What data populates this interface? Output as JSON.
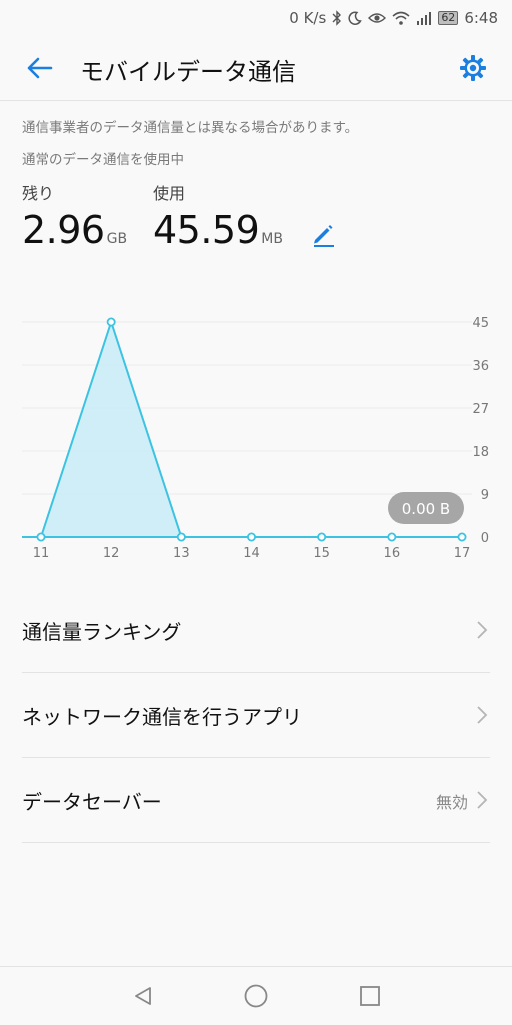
{
  "status_bar": {
    "speed": "0 K/s",
    "battery": "62",
    "time": "6:48",
    "icons": [
      "bluetooth-icon",
      "moon-icon",
      "eye-icon",
      "wifi-icon",
      "signal-icon",
      "battery-icon"
    ]
  },
  "header": {
    "title": "モバイルデータ通信",
    "back_icon": "arrow-left-icon",
    "settings_icon": "gear-icon"
  },
  "info": {
    "note": "通信事業者のデータ通信量とは異なる場合があります。",
    "status": "通常のデータ通信を使用中"
  },
  "stats": {
    "remaining_label": "残り",
    "remaining_value": "2.96",
    "remaining_unit": "GB",
    "used_label": "使用",
    "used_value": "45.59",
    "used_unit": "MB",
    "edit_icon": "pencil-icon"
  },
  "chart_data": {
    "type": "area",
    "x": [
      "11",
      "12",
      "13",
      "14",
      "15",
      "16",
      "17"
    ],
    "values": [
      0,
      45,
      0,
      0,
      0,
      0,
      0
    ],
    "yticks": [
      "45",
      "36",
      "27",
      "18",
      "9",
      "0"
    ],
    "ylim": [
      0,
      45
    ],
    "tooltip": "0.00 B",
    "grid": true,
    "colors": {
      "line": "#3cc3e2",
      "fill": "#c8ecf7",
      "tooltip": "#a6a6a6"
    }
  },
  "list": [
    {
      "label": "通信量ランキング",
      "value": ""
    },
    {
      "label": "ネットワーク通信を行うアプリ",
      "value": ""
    },
    {
      "label": "データセーバー",
      "value": "無効"
    }
  ],
  "nav": {
    "back_icon": "triangle-back-icon",
    "home_icon": "circle-home-icon",
    "recents_icon": "square-recents-icon"
  },
  "colors": {
    "accent": "#1a7fe0"
  }
}
